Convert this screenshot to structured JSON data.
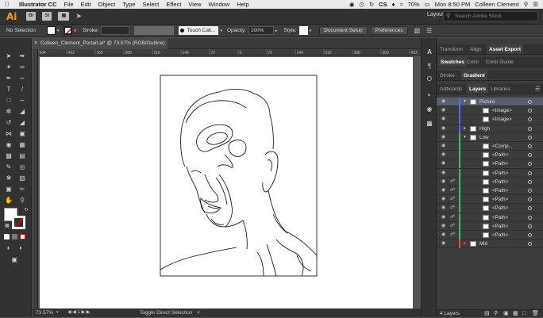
{
  "menubar": {
    "app_name": "Illustrator CC",
    "items": [
      "File",
      "Edit",
      "Object",
      "Type",
      "Select",
      "Effect",
      "View",
      "Window",
      "Help"
    ],
    "battery": "70%",
    "clock": "Mon 8:50 PM",
    "user": "Colleen Clement"
  },
  "appbar": {
    "logo": "Ai",
    "br_icon": "Br",
    "st_icon": "St",
    "workspace": "Layout",
    "search_placeholder": "Search Adobe Stock"
  },
  "controlbar": {
    "selection_state": "No Selection",
    "stroke_label": "Stroke:",
    "brush": "Touch Call...",
    "opacity_label": "Opacity:",
    "opacity_value": "100%",
    "style_label": "Style:",
    "document_setup": "Document Setup",
    "preferences": "Preferences"
  },
  "document": {
    "tab_title": "Colleen_Clement_Portait.ai* @ 73.57% (RGB/Outline)",
    "zoom": "73.57%",
    "status": "Toggle Direct Selection",
    "ruler_ticks": [
      "504",
      "432",
      "360",
      "288",
      "216",
      "144",
      "72",
      "0",
      "72",
      "144",
      "216",
      "288",
      "360",
      "432",
      "504",
      "576",
      "648",
      "720",
      "792",
      "864",
      "936",
      "1008",
      "1080"
    ]
  },
  "panels": {
    "row1_tabs": [
      "Transform",
      "Align",
      "Asset Export"
    ],
    "row2_tabs": [
      "Swatches",
      "Color",
      "Color Guide"
    ],
    "row3_tabs": [
      "Stroke",
      "Gradient"
    ],
    "row4_tabs": [
      "Artboards",
      "Layers",
      "Libraries"
    ],
    "layers_count": "4 Layers"
  },
  "layers": [
    {
      "name": "Picture",
      "depth": 0,
      "color": "#4a6cff",
      "twirl": "down",
      "selected": true,
      "locked": false
    },
    {
      "name": "<Image>",
      "depth": 1,
      "color": "#4a6cff",
      "twirl": "",
      "selected": false,
      "locked": false
    },
    {
      "name": "<Image>",
      "depth": 1,
      "color": "#4a6cff",
      "twirl": "",
      "selected": false,
      "locked": false
    },
    {
      "name": "High",
      "depth": 0,
      "color": "#4a6cff",
      "twirl": "right",
      "selected": false,
      "locked": false
    },
    {
      "name": "Low",
      "depth": 0,
      "color": "#2ecc40",
      "twirl": "down",
      "selected": false,
      "locked": false
    },
    {
      "name": "<Comp...",
      "depth": 1,
      "color": "#2ecc40",
      "twirl": "",
      "selected": false,
      "locked": false
    },
    {
      "name": "<Path>",
      "depth": 1,
      "color": "#2ecc40",
      "twirl": "",
      "selected": false,
      "locked": false
    },
    {
      "name": "<Path>",
      "depth": 1,
      "color": "#2ecc40",
      "twirl": "",
      "selected": false,
      "locked": false
    },
    {
      "name": "<Path>",
      "depth": 1,
      "color": "#2ecc40",
      "twirl": "",
      "selected": false,
      "locked": false
    },
    {
      "name": "<Path>",
      "depth": 1,
      "color": "#2ecc40",
      "twirl": "",
      "selected": false,
      "locked": true
    },
    {
      "name": "<Path>",
      "depth": 1,
      "color": "#2ecc40",
      "twirl": "",
      "selected": false,
      "locked": true
    },
    {
      "name": "<Path>",
      "depth": 1,
      "color": "#2ecc40",
      "twirl": "",
      "selected": false,
      "locked": true
    },
    {
      "name": "<Path>",
      "depth": 1,
      "color": "#2ecc40",
      "twirl": "",
      "selected": false,
      "locked": true
    },
    {
      "name": "<Path>",
      "depth": 1,
      "color": "#2ecc40",
      "twirl": "",
      "selected": false,
      "locked": true
    },
    {
      "name": "<Path>",
      "depth": 1,
      "color": "#2ecc40",
      "twirl": "",
      "selected": false,
      "locked": true
    },
    {
      "name": "<Path>",
      "depth": 1,
      "color": "#2ecc40",
      "twirl": "",
      "selected": false,
      "locked": true
    },
    {
      "name": "Mid",
      "depth": 0,
      "color": "#ff3b3b",
      "twirl": "right",
      "selected": false,
      "locked": false
    }
  ]
}
